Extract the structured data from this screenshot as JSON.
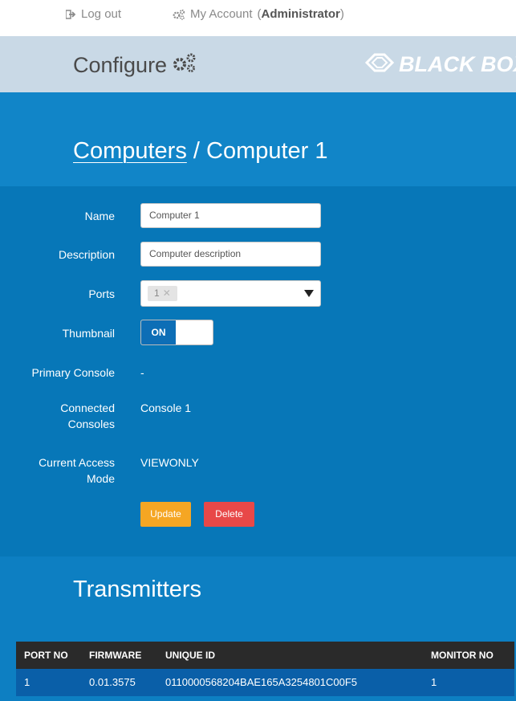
{
  "topbar": {
    "logout_label": "Log out",
    "account_label": "My Account",
    "account_role": "Administrator"
  },
  "header": {
    "title": "Configure",
    "brand": "BLACK BOX"
  },
  "breadcrumb": {
    "parent": "Computers",
    "separator": " / ",
    "current": "Computer 1"
  },
  "form": {
    "name_label": "Name",
    "name_value": "Computer 1",
    "description_label": "Description",
    "description_value": "Computer description",
    "ports_label": "Ports",
    "ports_selected": "1",
    "thumbnail_label": "Thumbnail",
    "thumbnail_state": "ON",
    "primary_console_label": "Primary Console",
    "primary_console_value": "-",
    "connected_consoles_label_1": "Connected",
    "connected_consoles_label_2": "Consoles",
    "connected_consoles_value": "Console 1",
    "access_mode_label_1": "Current Access",
    "access_mode_label_2": "Mode",
    "access_mode_value": "VIEWONLY",
    "update_label": "Update",
    "delete_label": "Delete"
  },
  "transmitters": {
    "title": "Transmitters",
    "columns": [
      "PORT NO",
      "FIRMWARE",
      "UNIQUE ID",
      "MONITOR NO"
    ],
    "rows": [
      [
        "1",
        "0.01.3575",
        "0110000568204BAE165A3254801C00F5",
        "1"
      ]
    ]
  },
  "colors": {
    "header_bg": "#c9d9e6",
    "panel_bg": "#0d7fc2",
    "update_button": "#f5a623",
    "delete_button": "#e84848",
    "table_header": "#2a2a2a"
  },
  "icons": {
    "logout": "logout-icon",
    "account": "gears-icon",
    "configure": "gears-icon",
    "brand": "diamond-logo-icon",
    "tag_remove": "close-icon",
    "dropdown": "caret-down-icon"
  }
}
